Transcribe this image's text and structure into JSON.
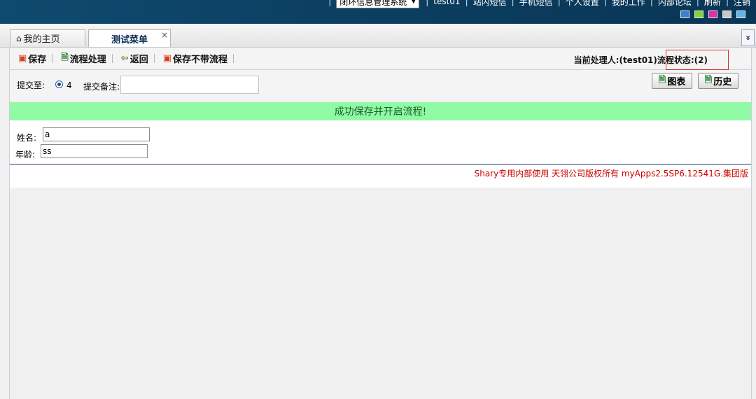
{
  "topbar": {
    "system_select": "闭环信息管理系统",
    "nav": [
      "test01",
      "站内短信",
      "手机短信",
      "个人设置",
      "我的工作",
      "内部论坛",
      "刷新",
      "注销"
    ],
    "swatch_colors": [
      "#3b7fd0",
      "#7fd63a",
      "#e02ea8",
      "#c8c8c8",
      "#5bb7ea"
    ]
  },
  "tabs": {
    "home_label": "我的主页",
    "active_label": "测试菜单",
    "close_glyph": "×",
    "expand_glyph": "»"
  },
  "toolbar": {
    "save_label": "保存",
    "process_label": "流程处理",
    "back_label": "返回",
    "save_noflow_label": "保存不带流程",
    "handler_text": "当前处理人:(test01)流程状态:(2)"
  },
  "submit": {
    "submit_to_label": "提交至:",
    "radio_value": "4",
    "remark_label": "提交备注:",
    "remark_value": "",
    "chart_button": "图表",
    "history_button": "历史"
  },
  "message": {
    "text": "成功保存并开启流程!"
  },
  "form": {
    "name_label": "姓名:",
    "name_value": "a",
    "age_label": "年龄:",
    "age_value": "ss"
  },
  "footer": {
    "text": "Shary专用内部使用  天翎公司版权所有  myApps2.5SP6.12541G.集团版"
  }
}
